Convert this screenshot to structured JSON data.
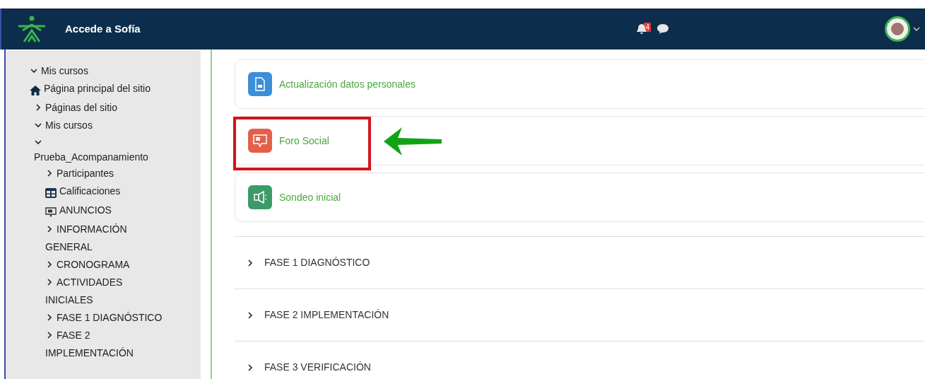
{
  "navbar": {
    "site_name": "Accede a Sofía",
    "notification_count": "4"
  },
  "sidebar": {
    "items": [
      {
        "label": "Mis cursos",
        "expanded": true
      },
      {
        "label": "Página principal del sitio",
        "kind": "home"
      },
      {
        "label": "Páginas del sitio",
        "expanded": false
      },
      {
        "label": "Mis cursos",
        "expanded": true,
        "children": [
          {
            "label": "Prueba_Acompanamiento",
            "expanded": true,
            "children": [
              {
                "label": "Participantes",
                "expanded": false
              },
              {
                "label": "Calificaciones",
                "kind": "grades"
              },
              {
                "label": "ANUNCIOS",
                "kind": "forum"
              },
              {
                "label": "INFORMACIÓN GENERAL",
                "expanded": false
              },
              {
                "label": "CRONOGRAMA",
                "expanded": false
              },
              {
                "label": "ACTIVIDADES INICIALES",
                "expanded": false
              },
              {
                "label": "FASE 1 DIAGNÓSTICO",
                "expanded": false
              },
              {
                "label": "FASE 2 IMPLEMENTACIÓN",
                "expanded": false
              }
            ]
          }
        ]
      }
    ]
  },
  "activities": [
    {
      "label": "Actualización datos personales",
      "kind": "assignment",
      "highlighted": false
    },
    {
      "label": "Foro Social",
      "kind": "forum",
      "highlighted": true
    },
    {
      "label": "Sondeo inicial",
      "kind": "survey",
      "highlighted": false
    }
  ],
  "sections": [
    {
      "label": "FASE 1 DIAGNÓSTICO",
      "expanded": false
    },
    {
      "label": "FASE 2 IMPLEMENTACIÓN",
      "expanded": false
    },
    {
      "label": "FASE 3 VERIFICACIÓN",
      "expanded": false
    }
  ]
}
